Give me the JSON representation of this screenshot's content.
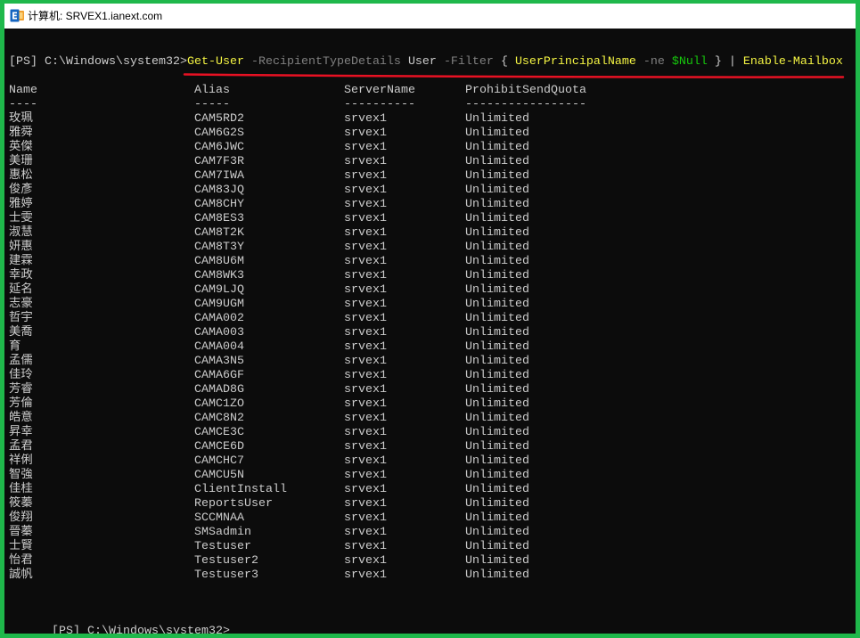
{
  "window": {
    "title": "计算机: SRVEX1.ianext.com",
    "icon": "exchange-management-shell-icon"
  },
  "colors": {
    "frame": "#1fb84b",
    "console_bg": "#0c0c0c",
    "text": "#cccccc",
    "underline": "#e81123"
  },
  "command": {
    "prompt": "[PS] C:\\Windows\\system32>",
    "tokens": [
      {
        "text": "Get-User",
        "color": "#f5f543"
      },
      {
        "text": "-RecipientTypeDetails",
        "color": "#808080"
      },
      {
        "text": "User",
        "color": "#cccccc"
      },
      {
        "text": "-Filter",
        "color": "#808080"
      },
      {
        "text": "{",
        "color": "#cccccc"
      },
      {
        "text": "UserPrincipalName",
        "color": "#f5f543"
      },
      {
        "text": "-ne",
        "color": "#808080"
      },
      {
        "text": "$Null",
        "color": "#16c60c"
      },
      {
        "text": "}",
        "color": "#cccccc"
      },
      {
        "text": "|",
        "color": "#cccccc"
      },
      {
        "text": "Enable-Mailbox",
        "color": "#f5f543"
      }
    ]
  },
  "table": {
    "headers": {
      "name": "Name",
      "alias": "Alias",
      "server": "ServerName",
      "quota": "ProhibitSendQuota"
    },
    "separators": {
      "name": "----",
      "alias": "-----",
      "server": "----------",
      "quota": "-----------------"
    },
    "rows": [
      {
        "name": "玫珮",
        "alias": "CAM5RD2",
        "server": "srvex1",
        "quota": "Unlimited"
      },
      {
        "name": "雅舜",
        "alias": "CAM6G2S",
        "server": "srvex1",
        "quota": "Unlimited"
      },
      {
        "name": "英傑",
        "alias": "CAM6JWC",
        "server": "srvex1",
        "quota": "Unlimited"
      },
      {
        "name": "美珊",
        "alias": "CAM7F3R",
        "server": "srvex1",
        "quota": "Unlimited"
      },
      {
        "name": "惠松",
        "alias": "CAM7IWA",
        "server": "srvex1",
        "quota": "Unlimited"
      },
      {
        "name": "俊彥",
        "alias": "CAM83JQ",
        "server": "srvex1",
        "quota": "Unlimited"
      },
      {
        "name": "雅婷",
        "alias": "CAM8CHY",
        "server": "srvex1",
        "quota": "Unlimited"
      },
      {
        "name": "士雯",
        "alias": "CAM8ES3",
        "server": "srvex1",
        "quota": "Unlimited"
      },
      {
        "name": "淑慧",
        "alias": "CAM8T2K",
        "server": "srvex1",
        "quota": "Unlimited"
      },
      {
        "name": "妍惠",
        "alias": "CAM8T3Y",
        "server": "srvex1",
        "quota": "Unlimited"
      },
      {
        "name": "建霖",
        "alias": "CAM8U6M",
        "server": "srvex1",
        "quota": "Unlimited"
      },
      {
        "name": "幸政",
        "alias": "CAM8WK3",
        "server": "srvex1",
        "quota": "Unlimited"
      },
      {
        "name": "延名",
        "alias": "CAM9LJQ",
        "server": "srvex1",
        "quota": "Unlimited"
      },
      {
        "name": "志豪",
        "alias": "CAM9UGM",
        "server": "srvex1",
        "quota": "Unlimited"
      },
      {
        "name": "哲宇",
        "alias": "CAMA002",
        "server": "srvex1",
        "quota": "Unlimited"
      },
      {
        "name": "美喬",
        "alias": "CAMA003",
        "server": "srvex1",
        "quota": "Unlimited"
      },
      {
        "name": "育",
        "alias": "CAMA004",
        "server": "srvex1",
        "quota": "Unlimited"
      },
      {
        "name": "孟儒",
        "alias": "CAMA3N5",
        "server": "srvex1",
        "quota": "Unlimited"
      },
      {
        "name": "佳玲",
        "alias": "CAMA6GF",
        "server": "srvex1",
        "quota": "Unlimited"
      },
      {
        "name": "芳睿",
        "alias": "CAMAD8G",
        "server": "srvex1",
        "quota": "Unlimited"
      },
      {
        "name": "芳倫",
        "alias": "CAMC1ZO",
        "server": "srvex1",
        "quota": "Unlimited"
      },
      {
        "name": "皓意",
        "alias": "CAMC8N2",
        "server": "srvex1",
        "quota": "Unlimited"
      },
      {
        "name": "昇幸",
        "alias": "CAMCE3C",
        "server": "srvex1",
        "quota": "Unlimited"
      },
      {
        "name": "孟君",
        "alias": "CAMCE6D",
        "server": "srvex1",
        "quota": "Unlimited"
      },
      {
        "name": "祥俐",
        "alias": "CAMCHC7",
        "server": "srvex1",
        "quota": "Unlimited"
      },
      {
        "name": "智強",
        "alias": "CAMCU5N",
        "server": "srvex1",
        "quota": "Unlimited"
      },
      {
        "name": "佳桂",
        "alias": "ClientInstall",
        "server": "srvex1",
        "quota": "Unlimited"
      },
      {
        "name": "筱蓁",
        "alias": "ReportsUser",
        "server": "srvex1",
        "quota": "Unlimited"
      },
      {
        "name": "俊翔",
        "alias": "SCCMNAA",
        "server": "srvex1",
        "quota": "Unlimited"
      },
      {
        "name": "晉蓁",
        "alias": "SMSadmin",
        "server": "srvex1",
        "quota": "Unlimited"
      },
      {
        "name": "士賢",
        "alias": "Testuser",
        "server": "srvex1",
        "quota": "Unlimited"
      },
      {
        "name": "怡君",
        "alias": "Testuser2",
        "server": "srvex1",
        "quota": "Unlimited"
      },
      {
        "name": "誠帆",
        "alias": "Testuser3",
        "server": "srvex1",
        "quota": "Unlimited"
      }
    ]
  },
  "next_prompt": "[PS] C:\\Windows\\system32>"
}
